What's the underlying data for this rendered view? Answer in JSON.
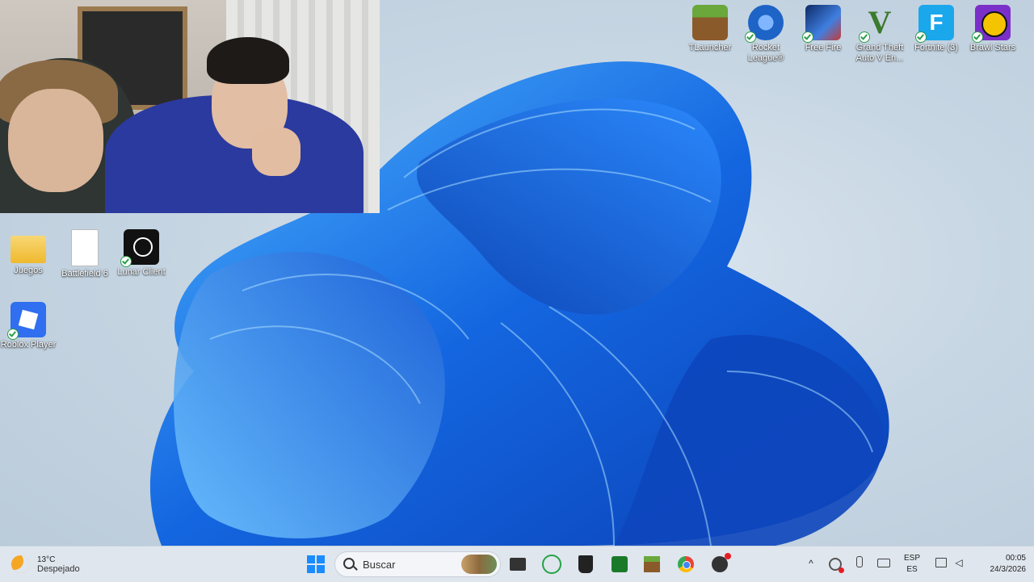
{
  "desktop": {
    "icons_top_right": [
      {
        "label": "TLauncher",
        "icon": "minecraft-grass-icon",
        "color": "#5d8a3a"
      },
      {
        "label": "Rocket League®",
        "icon": "rocket-league-icon",
        "color": "#1e63c6"
      },
      {
        "label": "Free Fire",
        "icon": "free-fire-icon",
        "color": "#1d4fa0"
      },
      {
        "label": "Grand Theft Auto V En...",
        "icon": "gta-v-icon",
        "color": "#3c7a2d"
      },
      {
        "label": "Fortnite (3)",
        "icon": "fortnite-icon",
        "color": "#1aa7ec"
      },
      {
        "label": "Brawl Stars",
        "icon": "brawl-stars-icon",
        "color": "#7b2fc9"
      }
    ],
    "icons_left": [
      {
        "label": "Juegos",
        "icon": "folder-icon",
        "color": "#f3c545"
      },
      {
        "label": "Battlefield 6",
        "icon": "file-icon",
        "color": "#ffffff"
      },
      {
        "label": "Lunar Client",
        "icon": "lunar-client-icon",
        "color": "#111111"
      },
      {
        "label": "Roblox Player",
        "icon": "roblox-icon",
        "color": "#2f6ff0"
      }
    ]
  },
  "taskbar": {
    "weather": {
      "temp": "13°C",
      "condition": "Despejado"
    },
    "search_placeholder": "Buscar",
    "apps": [
      "start-icon",
      "file-explorer-icon",
      "whatsapp-icon",
      "epic-games-icon",
      "xbox-icon",
      "minecraft-icon",
      "chrome-icon",
      "obs-icon"
    ],
    "tray": {
      "lang_top": "ESP",
      "lang_bottom": "ES",
      "time": "00:05",
      "date": "24/3/2026"
    }
  },
  "colors": {
    "accent": "#1a73e8",
    "taskbar": "#dfe6ee"
  }
}
